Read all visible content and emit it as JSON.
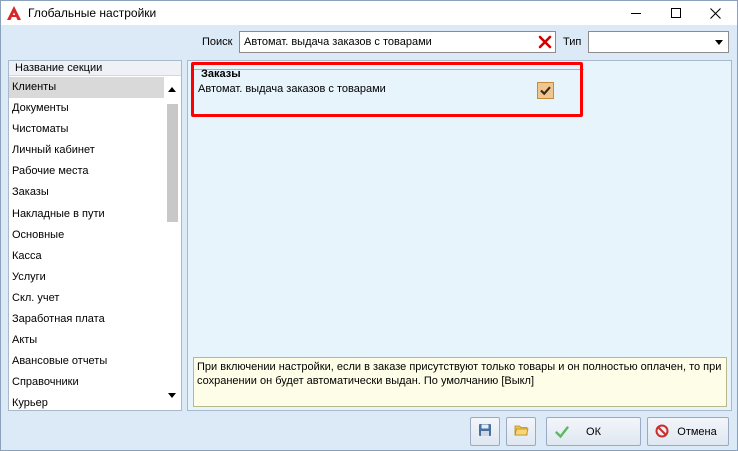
{
  "window": {
    "title": "Глобальные настройки"
  },
  "search": {
    "label": "Поиск",
    "value": "Автомат. выдача заказов с товарами",
    "placeholder": ""
  },
  "type_filter": {
    "label": "Тип",
    "value": ""
  },
  "sections": {
    "header": "Название секции",
    "items": [
      {
        "label": "Клиенты",
        "selected": true
      },
      {
        "label": "Документы"
      },
      {
        "label": "Чистоматы"
      },
      {
        "label": "Личный кабинет"
      },
      {
        "label": "Рабочие места"
      },
      {
        "label": "Заказы"
      },
      {
        "label": "Накладные в пути"
      },
      {
        "label": "Основные"
      },
      {
        "label": "Касса"
      },
      {
        "label": "Услуги"
      },
      {
        "label": "Скл. учет"
      },
      {
        "label": "Заработная плата"
      },
      {
        "label": "Акты"
      },
      {
        "label": "Авансовые отчеты"
      },
      {
        "label": "Справочники"
      },
      {
        "label": "Курьер"
      }
    ]
  },
  "settings": {
    "group_title": "Заказы",
    "setting_label": "Автомат. выдача заказов с товарами",
    "setting_checked": true,
    "description": "При включении настройки, если в заказе присутствуют только товары и он полностью оплачен, то при сохранении он будет автоматически выдан. По умолчанию [Выкл]"
  },
  "buttons": {
    "ok_label": "ОК",
    "cancel_label": "Отмена"
  },
  "colors": {
    "window_bg": "#dce9f7",
    "settings_bg": "#e7f4fc",
    "highlight": "#ff0000",
    "description_bg": "#fefee8",
    "checkbox_bg": "#f0c68f",
    "app_icon": "#d9262a"
  },
  "icons": {
    "app": "app-logo-icon",
    "minimize": "minimize-icon",
    "maximize": "maximize-icon",
    "close": "close-icon",
    "clear": "clear-x-icon",
    "save": "floppy-disk-icon",
    "open": "folder-icon",
    "ok": "checkmark-icon",
    "cancel": "no-entry-icon"
  }
}
